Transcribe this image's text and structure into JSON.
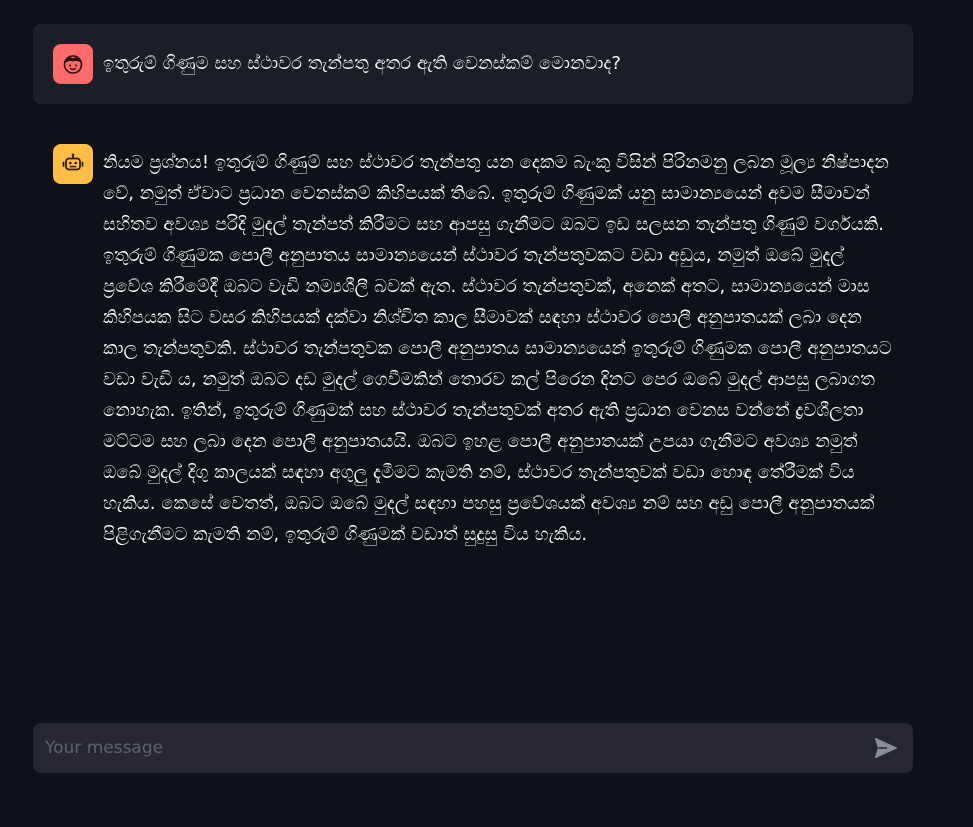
{
  "colors": {
    "background": "#0e1117",
    "user_bubble": "#1b1e26",
    "user_avatar": "#ff6b6b",
    "assistant_avatar": "#ffbd45",
    "input_background": "#262730",
    "send_icon": "#8b8d95"
  },
  "messages": {
    "user": {
      "avatar_icon": "user-face-icon",
      "text": "ඉතුරුම් ගිණුම සහ ස්ථාවර තැන්පතු අතර ඇති වෙනස්කම් මොනවාද?"
    },
    "assistant": {
      "avatar_icon": "robot-icon",
      "text": "නියම ප්‍රශ්නය! ඉතුරුම් ගිණුම් සහ ස්ථාවර තැන්පතු යන දෙකම බැංකු විසින් පිරිනමනු ලබන මූල්‍ය නිෂ්පාදන වේ, නමුත් ඒවාට ප්‍රධාන වෙනස්කම් කිහිපයක් තිබේ. ඉතුරුම් ගිණුමක් යනු සාමාන්‍යයෙන් අවම සීමාවන් සහිතව අවශ්‍ය පරිදි මුදල් තැන්පත් කිරීමට සහ ආපසු ගැනීමට ඔබට ඉඩ සලසන තැන්පතු ගිණුම් වර්ගයකි. ඉතුරුම් ගිණුමක පොලී අනුපාතය සාමාන්‍යයෙන් ස්ථාවර තැන්පතුවකට වඩා අඩුය, නමුත් ඔබේ මුදල් ප්‍රවේශ කිරීමේදී ඔබට වැඩි නම්‍යශීලී බවක් ඇත. ස්ථාවර තැන්පතුවක්, අනෙක් අතට, සාමාන්‍යයෙන් මාස කිහිපයක සිට වසර කිහිපයක් දක්වා නිශ්චිත කාල සීමාවක් සඳහා ස්ථාවර පොලී අනුපාතයක් ලබා දෙන කාල තැන්පතුවකි. ස්ථාවර තැන්පතුවක පොලී අනුපාතය සාමාන්‍යයෙන් ඉතුරුම් ගිණුමක පොලී අනුපාතයට වඩා වැඩි ය, නමුත් ඔබට දඩ මුදල් ගෙවීමකින් තොරව කල් පිරෙන දිනට පෙර ඔබේ මුදල් ආපසු ලබාගත නොහැක. ඉතින්, ඉතුරුම් ගිණුමක් සහ ස්ථාවර තැන්පතුවක් අතර ඇති ප්‍රධාන වෙනස වන්නේ ද්‍රවශීලතා මට්ටම සහ ලබා දෙන පොලී අනුපාතයයි. ඔබට ඉහළ පොලී අනුපාතයක් උපයා ගැනීමට අවශ්‍ය නමුත් ඔබේ මුදල් දිගු කාලයක් සඳහා අගුලු දැමීමට කැමති නම්, ස්ථාවර තැන්පතුවක් වඩා හොඳ තේරීමක් විය හැකිය. කෙසේ වෙතත්, ඔබට ඔබේ මුදල් සඳහා පහසු ප්‍රවේශයක් අවශ්‍ය නම් සහ අඩු පොලී අනුපාතයක් පිළිගැනීමට කැමති නම්, ඉතුරුම් ගිණුමක් වඩාත් සුදුසු විය හැකිය."
    }
  },
  "input": {
    "placeholder": "Your message",
    "value": "",
    "send_icon": "send-icon"
  }
}
